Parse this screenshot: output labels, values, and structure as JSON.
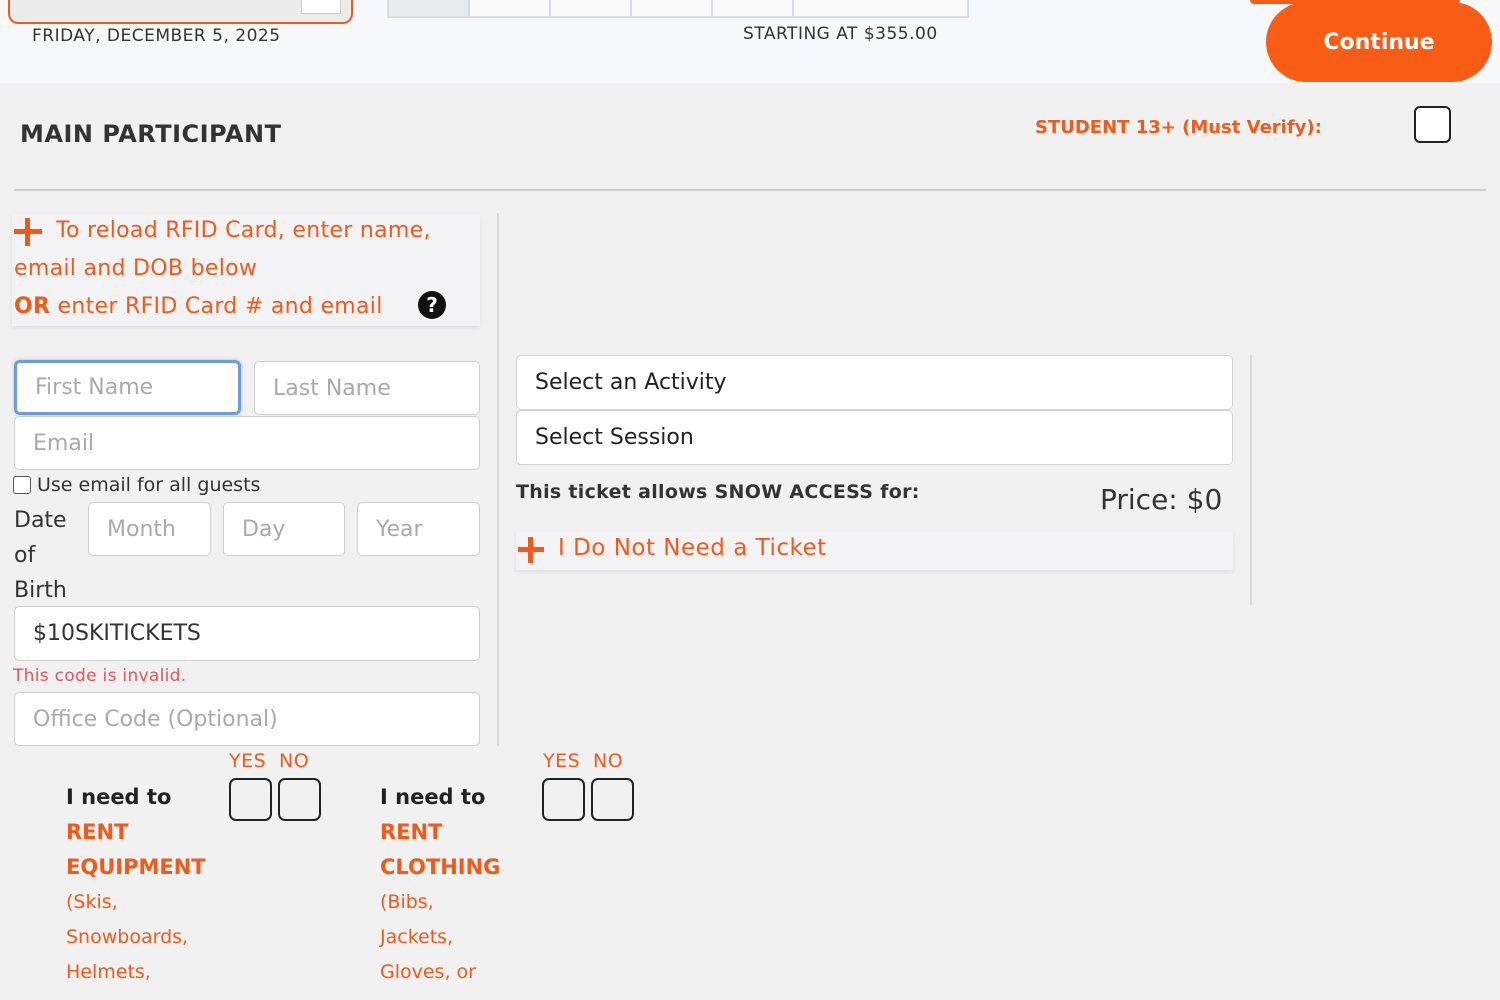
{
  "header": {
    "date_input_text": "2025-12-05",
    "date_caption": "FRIDAY, DECEMBER 5, 2025",
    "starting_at": "STARTING AT $355.00",
    "continue_label": "Continue"
  },
  "participant": {
    "title": "MAIN PARTICIPANT",
    "student_label": "STUDENT 13+ (Must Verify):",
    "student_checked": false
  },
  "rfid": {
    "line1": "To reload RFID Card, enter name,",
    "line2": "email and DOB below",
    "or_word": "OR",
    "line3": " enter RFID Card # and email",
    "help_icon": "question-circle-icon"
  },
  "form": {
    "first_name_placeholder": "First Name",
    "last_name_placeholder": "Last Name",
    "email_placeholder": "Email",
    "use_email_label": "Use email for all guests",
    "dob_label_1": "Date",
    "dob_label_2": "of",
    "dob_label_3": "Birth",
    "month_placeholder": "Month",
    "day_placeholder": "Day",
    "year_placeholder": "Year",
    "promo_value": "$10SKITICKETS",
    "promo_error": "This code is invalid.",
    "office_code_placeholder": "Office Code (Optional)"
  },
  "ticket": {
    "activity_select": "Select an Activity",
    "session_select": "Select Session",
    "snow_access_label": "This ticket allows SNOW ACCESS for:",
    "price": "Price: $0",
    "no_ticket_label": "I Do Not Need a Ticket"
  },
  "rentals": [
    {
      "yes": "YES",
      "no": "NO",
      "line1": "I need to",
      "line2": "RENT",
      "line3": "EQUIPMENT",
      "line4": "(Skis,",
      "line5": "Snowboards,",
      "line6": "Helmets,"
    },
    {
      "yes": "YES",
      "no": "NO",
      "line1": "I need to",
      "line2": "RENT",
      "line3": "CLOTHING",
      "line4": "(Bibs,",
      "line5": "Jackets,",
      "line6": "Gloves, or"
    }
  ],
  "colors": {
    "accent": "#f95d15",
    "error": "#e0555f"
  }
}
